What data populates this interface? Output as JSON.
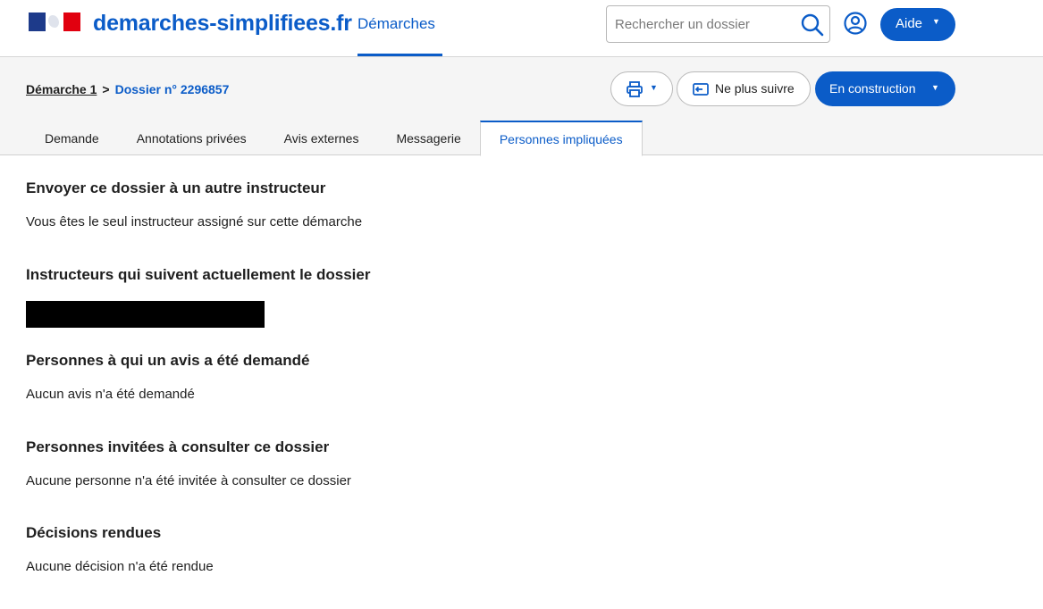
{
  "header": {
    "brand": "demarches-simplifiees.fr",
    "nav_item": "Démarches",
    "search_placeholder": "Rechercher un dossier",
    "help_label": "Aide",
    "accent_color": "#0b5cc8"
  },
  "breadcrumb": {
    "procedure": "Démarche 1",
    "separator": ">",
    "dossier": "Dossier n° 2296857"
  },
  "actions": {
    "print_icon": "printer-icon",
    "unfollow_label": "Ne plus suivre",
    "status_label": "En construction"
  },
  "tabs": [
    {
      "label": "Demande",
      "active": false
    },
    {
      "label": "Annotations privées",
      "active": false
    },
    {
      "label": "Avis externes",
      "active": false
    },
    {
      "label": "Messagerie",
      "active": false
    },
    {
      "label": "Personnes impliquées",
      "active": true
    }
  ],
  "sections": [
    {
      "title": "Envoyer ce dossier à un autre instructeur",
      "text": "Vous êtes le seul instructeur assigné sur cette démarche"
    },
    {
      "title": "Instructeurs qui suivent actuellement le dossier",
      "text": ""
    },
    {
      "title": "Personnes à qui un avis a été demandé",
      "text": "Aucun avis n'a été demandé"
    },
    {
      "title": "Personnes invitées à consulter ce dossier",
      "text": "Aucune personne n'a été invitée à consulter ce dossier"
    },
    {
      "title": "Décisions rendues",
      "text": "Aucune décision n'a été rendue"
    }
  ]
}
